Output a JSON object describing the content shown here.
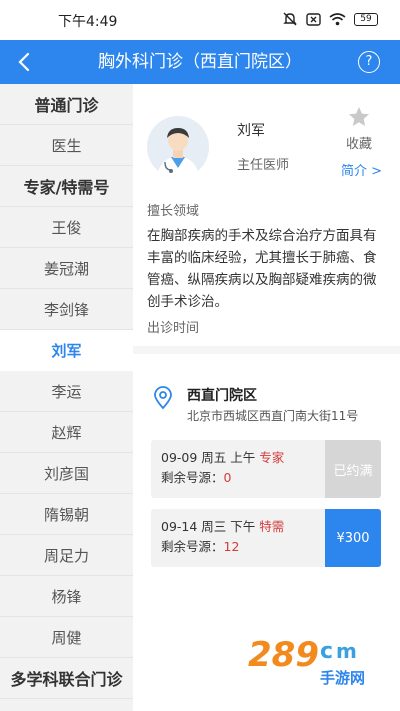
{
  "status_bar": {
    "time": "下午4:49",
    "battery": "59",
    "icons": [
      "mute-icon",
      "close-box-icon",
      "wifi-icon",
      "battery-icon"
    ]
  },
  "header": {
    "title": "胸外科门诊（西直门院区）",
    "help": "?"
  },
  "sidebar": {
    "items": [
      {
        "label": "普通门诊",
        "type": "header"
      },
      {
        "label": "医生",
        "type": "item"
      },
      {
        "label": "专家/特需号",
        "type": "header"
      },
      {
        "label": "王俊",
        "type": "item"
      },
      {
        "label": "姜冠潮",
        "type": "item"
      },
      {
        "label": "李剑锋",
        "type": "item"
      },
      {
        "label": "刘军",
        "type": "active"
      },
      {
        "label": "李运",
        "type": "item"
      },
      {
        "label": "赵辉",
        "type": "item"
      },
      {
        "label": "刘彦国",
        "type": "item"
      },
      {
        "label": "隋锡朝",
        "type": "item"
      },
      {
        "label": "周足力",
        "type": "item"
      },
      {
        "label": "杨锋",
        "type": "item"
      },
      {
        "label": "周健",
        "type": "item"
      },
      {
        "label": "多学科联合门诊",
        "type": "header"
      }
    ]
  },
  "doctor": {
    "name": "刘军",
    "title": "主任医师",
    "favorite_label": "收藏",
    "intro_link": "简介 >"
  },
  "specialty": {
    "label": "擅长领域",
    "text": "在胸部疾病的手术及综合治疗方面具有丰富的临床经验，尤其擅长于肺癌、食管癌、纵隔疾病以及胸部疑难疾病的微创手术诊治。"
  },
  "schedule": {
    "label": "出诊时间",
    "branch_name": "西直门院区",
    "branch_address": "北京市西城区西直门南大街11号",
    "slots": [
      {
        "date": "09-09 周五 上午",
        "kind": "专家",
        "remaining_label": "剩余号源：",
        "remaining": "0",
        "action": "已约满"
      },
      {
        "date": "09-14 周三 下午",
        "kind": "特需",
        "remaining_label": "剩余号源：",
        "remaining": "12",
        "action": "¥300"
      }
    ]
  },
  "watermark": {
    "logo": "289",
    "site": "手游网"
  },
  "colors": {
    "primary": "#2d86ee",
    "accent_red": "#d23c3c",
    "sidebar_bg": "#f2f2f2",
    "slot_full_bg": "#d6d6d6"
  }
}
